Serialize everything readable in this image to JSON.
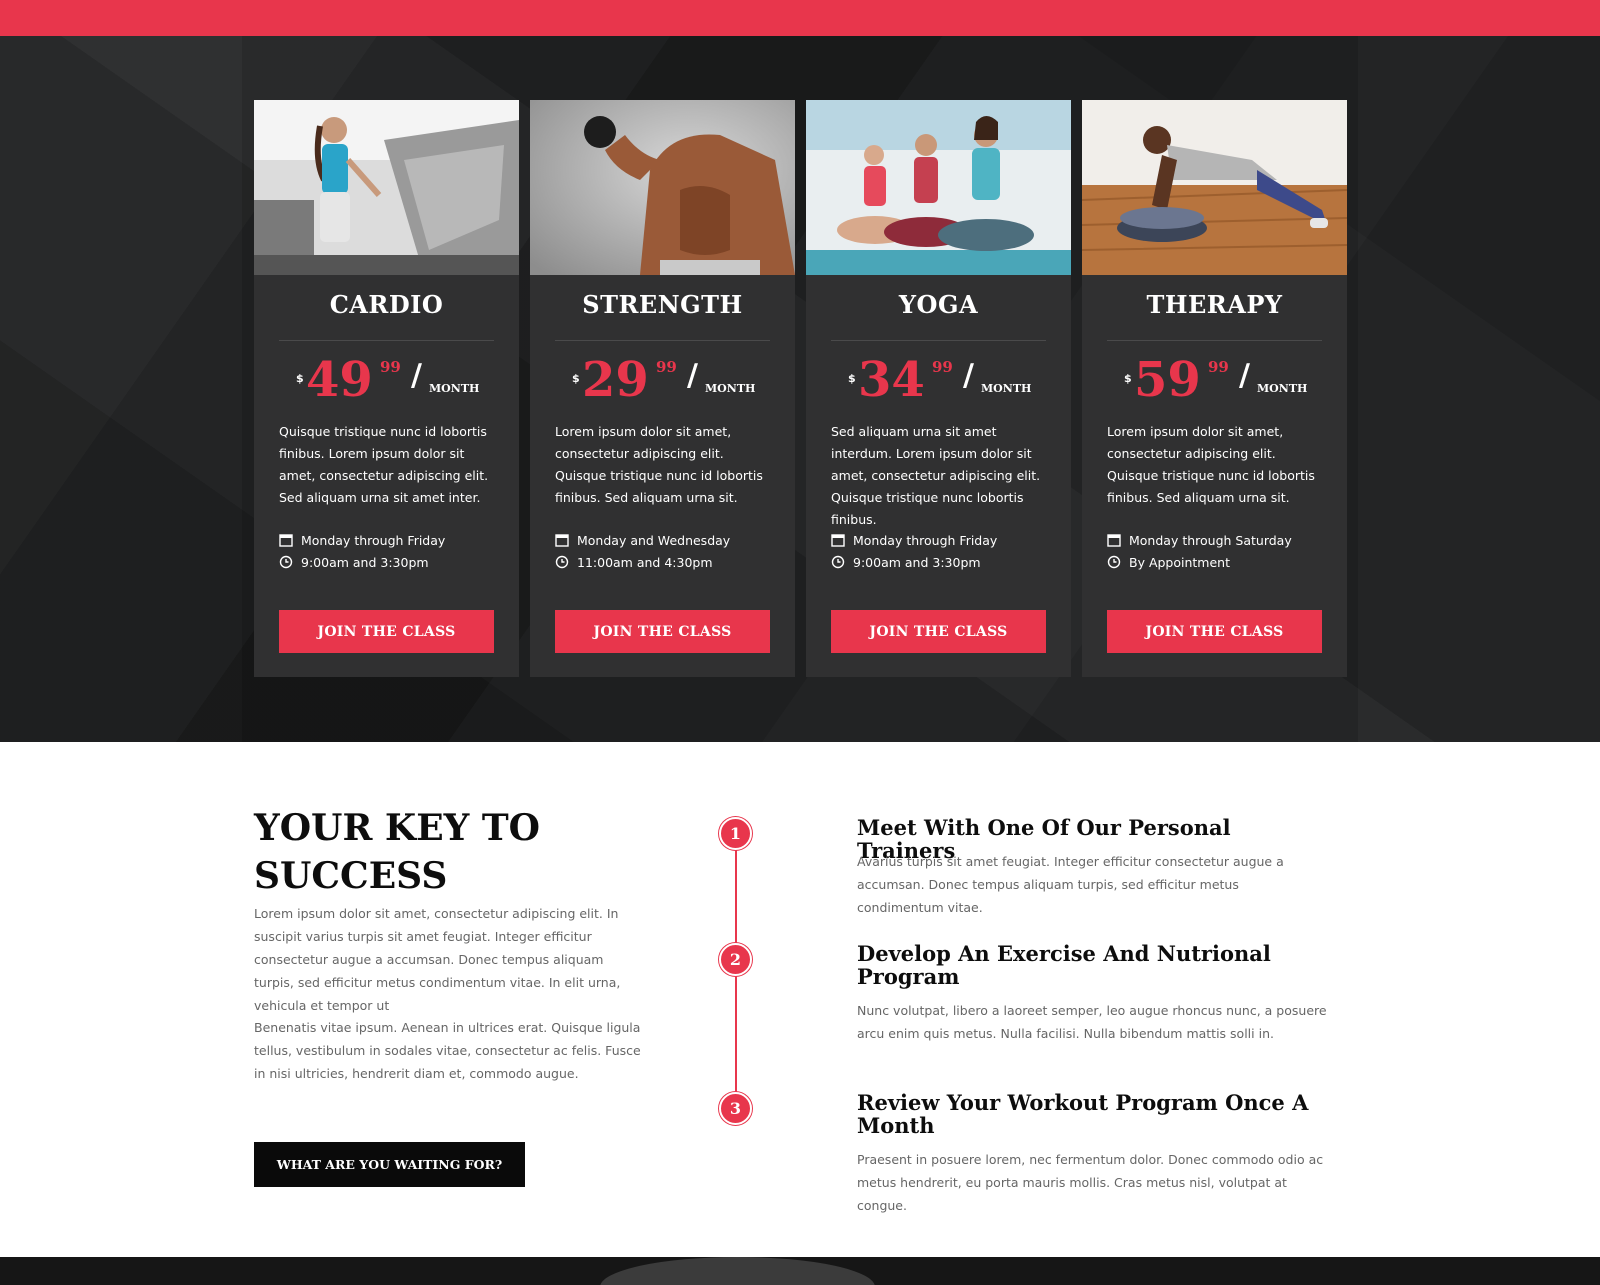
{
  "colors": {
    "accent": "#e8364c",
    "dark": "#232425",
    "card": "#303031"
  },
  "pricing": {
    "cards": [
      {
        "title": "CARDIO",
        "currency": "$",
        "amount": "49",
        "cents": "99",
        "slash": "/",
        "period": "MONTH",
        "description": "Quisque tristique nunc id lobortis finibus. Lorem ipsum dolor sit amet, consectetur adipiscing elit. Sed aliquam urna sit amet inter.",
        "days": "Monday through Friday",
        "times": "9:00am and 3:30pm",
        "button": "JOIN THE CLASS",
        "image": "woman-on-treadmill"
      },
      {
        "title": "STRENGTH",
        "currency": "$",
        "amount": "29",
        "cents": "99",
        "slash": "/",
        "period": "MONTH",
        "description": "Lorem ipsum dolor sit amet, consectetur adipiscing elit. Quisque tristique nunc id lobortis finibus. Sed aliquam urna sit.",
        "days": "Monday and Wednesday",
        "times": "11:00am and 4:30pm",
        "button": "JOIN THE CLASS",
        "image": "man-lifting-dumbbell"
      },
      {
        "title": "YOGA",
        "currency": "$",
        "amount": "34",
        "cents": "99",
        "slash": "/",
        "period": "MONTH",
        "description": "Sed aliquam urna sit amet interdum. Lorem ipsum dolor sit amet, consectetur adipiscing elit. Quisque tristique nunc lobortis finibus.",
        "days": "Monday through Friday",
        "times": "9:00am and 3:30pm",
        "button": "JOIN THE CLASS",
        "image": "women-meditating"
      },
      {
        "title": "THERAPY",
        "currency": "$",
        "amount": "59",
        "cents": "99",
        "slash": "/",
        "period": "MONTH",
        "description": "Lorem ipsum dolor sit amet, consectetur adipiscing elit. Quisque tristique nunc id lobortis finibus. Sed aliquam urna sit.",
        "days": "Monday through Saturday",
        "times": "By Appointment",
        "button": "JOIN THE CLASS",
        "image": "man-balance-pushup"
      }
    ]
  },
  "key": {
    "title": "YOUR KEY TO SUCCESS",
    "paragraph1": "Lorem ipsum dolor sit amet, consectetur adipiscing elit. In suscipit varius turpis sit amet feugiat. Integer efficitur consectetur augue a accumsan. Donec tempus aliquam turpis, sed efficitur metus condimentum vitae. In elit urna, vehicula et tempor ut",
    "paragraph2": "Benenatis vitae ipsum. Aenean in ultrices erat. Quisque ligula tellus, vestibulum in sodales vitae, consectetur ac felis. Fusce in nisi ultricies, hendrerit diam et, commodo augue.",
    "cta": "WHAT ARE YOU WAITING FOR?",
    "steps": [
      {
        "number": "1",
        "title": "Meet With One Of Our Personal Trainers",
        "text": "Avarius turpis sit amet feugiat. Integer efficitur consectetur augue a accumsan. Donec tempus aliquam turpis, sed efficitur metus condimentum vitae."
      },
      {
        "number": "2",
        "title": "Develop An Exercise And Nutrional Program",
        "text": "Nunc volutpat, libero a laoreet semper, leo augue rhoncus nunc, a posuere arcu enim quis metus. Nulla facilisi. Nulla bibendum mattis solli in."
      },
      {
        "number": "3",
        "title": "Review Your Workout Program Once A Month",
        "text": "Praesent in posuere lorem, nec fermentum dolor. Donec commodo odio ac metus hendrerit, eu porta mauris mollis. Cras metus nisl, volutpat at congue."
      }
    ]
  },
  "icons": {
    "calendar": "calendar-icon",
    "clock": "clock-icon"
  }
}
